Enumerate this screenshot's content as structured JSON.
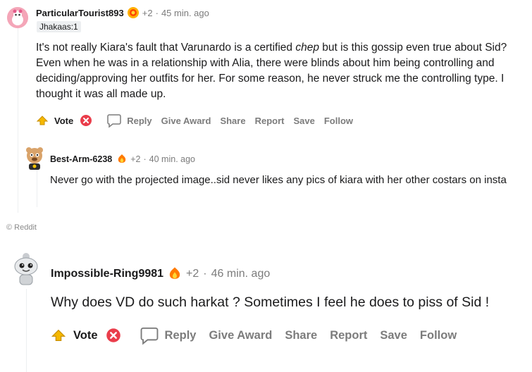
{
  "comment1": {
    "username": "ParticularTourist893",
    "points": "+2",
    "dot": "·",
    "time": "45 min. ago",
    "flair": "Jhakaas:1",
    "body_parts": {
      "a": "It's not really Kiara's fault that Varunardo is a certified ",
      "em": "chep",
      "b": " but is this gossip even true about Sid? Even when he was in a relationship with Alia, there were blinds about him being controlling and deciding/approving her outfits for her. For some reason, he never struck me the controlling type. I thought it was all made up."
    },
    "actions": {
      "vote": "Vote",
      "reply": "Reply",
      "award": "Give Award",
      "share": "Share",
      "report": "Report",
      "save": "Save",
      "follow": "Follow"
    }
  },
  "comment2": {
    "username": "Best-Arm-6238",
    "points": "+2",
    "dot": "·",
    "time": "40 min. ago",
    "body": "Never go with the projected image..sid never likes any pics of kiara with her other costars on insta"
  },
  "watermark": "© Reddit",
  "comment3": {
    "username": "Impossible-Ring9981",
    "points": "+2",
    "dot": "·",
    "time": "46 min. ago",
    "body": "Why does VD do such harkat ? Sometimes I feel he does to piss of Sid !",
    "actions": {
      "vote": "Vote",
      "reply": "Reply",
      "award": "Give Award",
      "share": "Share",
      "report": "Report",
      "save": "Save",
      "follow": "Follow"
    }
  },
  "colors": {
    "text": "#1a1a1b",
    "meta": "#7c7c7c",
    "thread": "#edeff1",
    "upvote": "#f5b800",
    "downvote": "#ea3d4b"
  }
}
